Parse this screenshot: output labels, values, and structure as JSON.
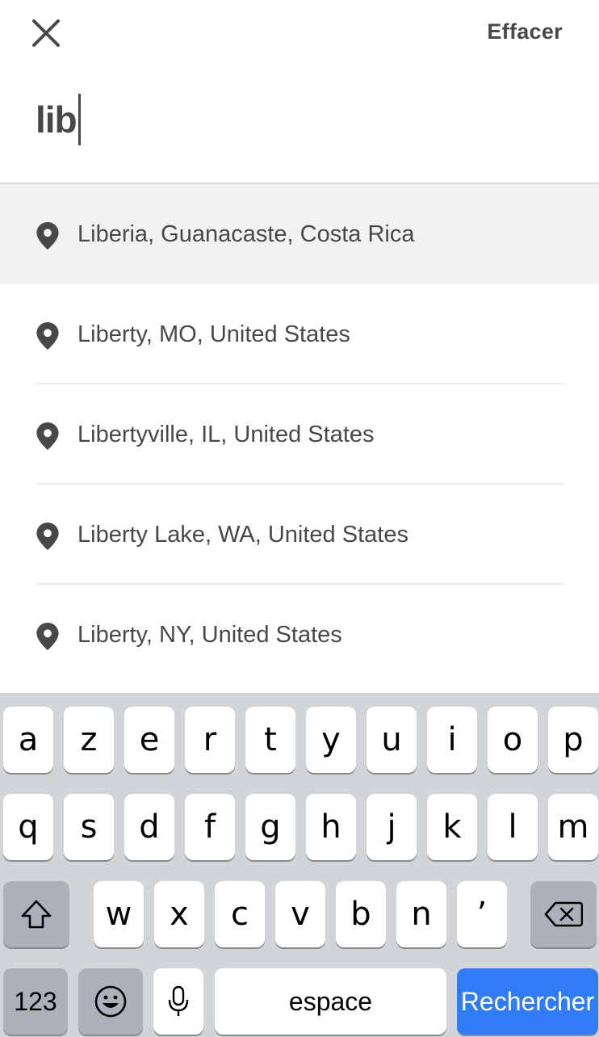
{
  "header": {
    "clear_label": "Effacer",
    "search_value": "lib"
  },
  "results": [
    {
      "label": "Liberia, Guanacaste, Costa Rica",
      "highlighted": true
    },
    {
      "label": "Liberty, MO, United States",
      "highlighted": false
    },
    {
      "label": "Libertyville, IL, United States",
      "highlighted": false
    },
    {
      "label": "Liberty Lake, WA, United States",
      "highlighted": false
    },
    {
      "label": "Liberty, NY, United States",
      "highlighted": false
    }
  ],
  "keyboard": {
    "row1": [
      "a",
      "z",
      "e",
      "r",
      "t",
      "y",
      "u",
      "i",
      "o",
      "p"
    ],
    "row2": [
      "q",
      "s",
      "d",
      "f",
      "g",
      "h",
      "j",
      "k",
      "l",
      "m"
    ],
    "row3": [
      "w",
      "x",
      "c",
      "v",
      "b",
      "n",
      "’"
    ],
    "numbers_label": "123",
    "space_label": "espace",
    "return_label": "Rechercher"
  },
  "colors": {
    "accent_return_key": "#2f7cf6",
    "text": "#484848",
    "highlight_row": "#f2f2f2",
    "keyboard_bg": "#d1d4d9"
  },
  "icons": [
    "close-icon",
    "map-pin-icon",
    "shift-icon",
    "backspace-icon",
    "emoji-icon",
    "microphone-icon"
  ]
}
